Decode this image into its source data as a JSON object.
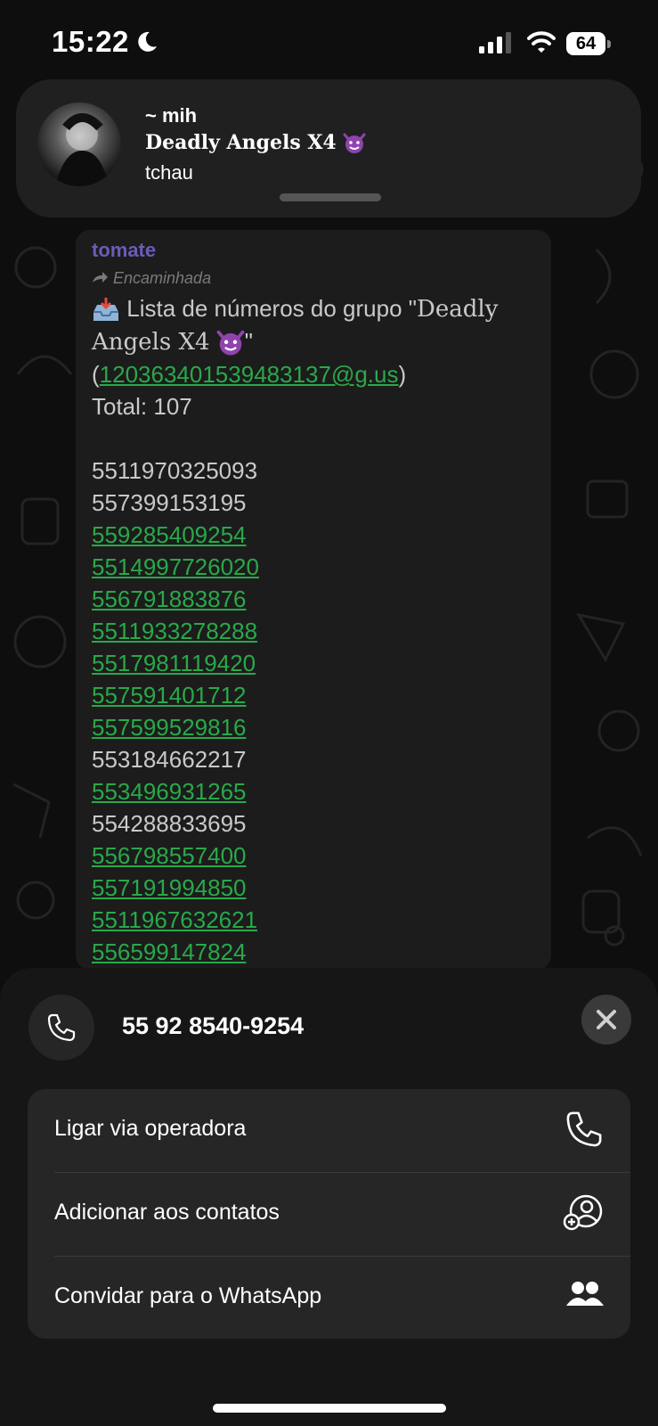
{
  "status_bar": {
    "time": "15:22",
    "battery": "64",
    "moon_icon": "moon-icon",
    "signal_icon": "cellular-signal-icon",
    "wifi_icon": "wifi-icon"
  },
  "notification": {
    "sender": "~ mih",
    "group": "Deadly Angels X4",
    "group_emoji_icon": "smiling-imp-emoji",
    "message": "tchau"
  },
  "message": {
    "author": "tomate",
    "forwarded_label": "Encaminhada",
    "intro_icon": "inbox-tray-emoji",
    "intro_text": "Lista de números do grupo \"",
    "group_name": "Deadly Angels X4",
    "after_group": "\"",
    "open_paren": "(",
    "group_id": "120363401539483137@g.us",
    "close_paren": ")",
    "total": "Total: 107",
    "numbers": [
      {
        "value": "5511970325093",
        "link": false
      },
      {
        "value": "557399153195",
        "link": false
      },
      {
        "value": "559285409254",
        "link": true
      },
      {
        "value": "5514997726020",
        "link": true
      },
      {
        "value": "556791883876",
        "link": true
      },
      {
        "value": "5511933278288",
        "link": true
      },
      {
        "value": "5517981119420",
        "link": true
      },
      {
        "value": "557591401712",
        "link": true
      },
      {
        "value": "557599529816",
        "link": true
      },
      {
        "value": "553184662217",
        "link": false
      },
      {
        "value": "553496931265",
        "link": true
      },
      {
        "value": "554288833695",
        "link": false
      },
      {
        "value": "556798557400",
        "link": true
      },
      {
        "value": "557191994850",
        "link": true
      },
      {
        "value": "5511967632621",
        "link": true
      },
      {
        "value": "556599147824",
        "link": true
      }
    ]
  },
  "sheet": {
    "phone_number": "55 92 8540-9254",
    "actions": [
      {
        "label": "Ligar via operadora",
        "icon": "phone-icon"
      },
      {
        "label": "Adicionar aos contatos",
        "icon": "add-contact-icon"
      },
      {
        "label": "Convidar para o WhatsApp",
        "icon": "people-icon"
      }
    ]
  },
  "colors": {
    "link_green": "#2aa84a",
    "author_purple": "#6b5bb8",
    "bubble_bg": "#1c1c1c",
    "sheet_bg": "#161616"
  }
}
